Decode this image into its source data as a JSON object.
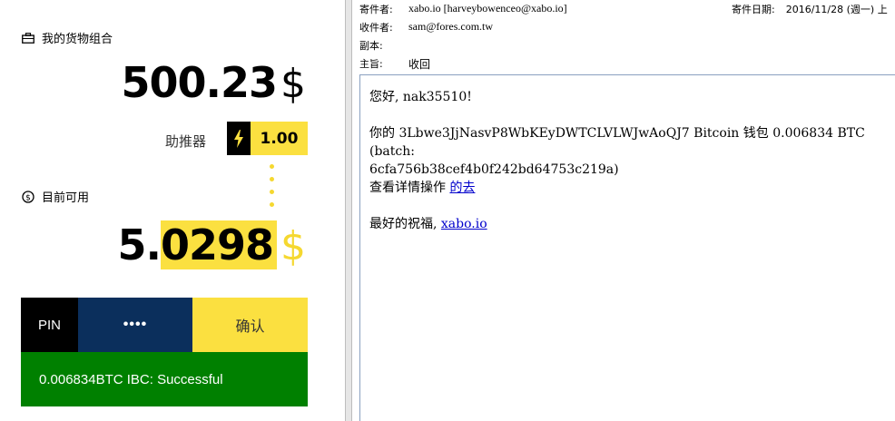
{
  "wallet": {
    "portfolio_label": "我的货物组合",
    "portfolio_amount": "500.23",
    "currency_symbol": "$",
    "booster_label": "助推器",
    "booster_value": "1.00",
    "available_label": "目前可用",
    "available_amount_prefix": "5.",
    "available_amount_highlight": "0298",
    "pin_label": "PIN",
    "pin_value": "••••",
    "confirm_label": "确认",
    "status_message": "0.006834BTC IBC: Successful",
    "colors": {
      "accent_yellow": "#fbe040",
      "navy": "#0b2f5c",
      "success_green": "#008000"
    }
  },
  "email": {
    "header": {
      "from_label": "寄件者:",
      "from_value": "xabo.io [harveybowenceo@xabo.io]",
      "date_label": "寄件日期:",
      "date_value": "2016/11/28 (週一) 上",
      "to_label": "收件者:",
      "to_value": "sam@fores.com.tw",
      "cc_label": "副本:",
      "cc_value": "",
      "subject_label": "主旨:",
      "subject_value": "收回"
    },
    "body": {
      "greeting": "您好, nak35510!",
      "line1": "你的 3Lbwe3JjNasvP8WbKEyDWTCLVLWJwAoQJ7 Bitcoin 钱包 0.006834 BTC (batch:",
      "line2": "6cfa756b38cef4b0f242bd64753c219a)",
      "details_text": "查看详情操作",
      "details_link": "的去",
      "closing_text": "最好的祝福,",
      "closing_link": "xabo.io"
    }
  }
}
